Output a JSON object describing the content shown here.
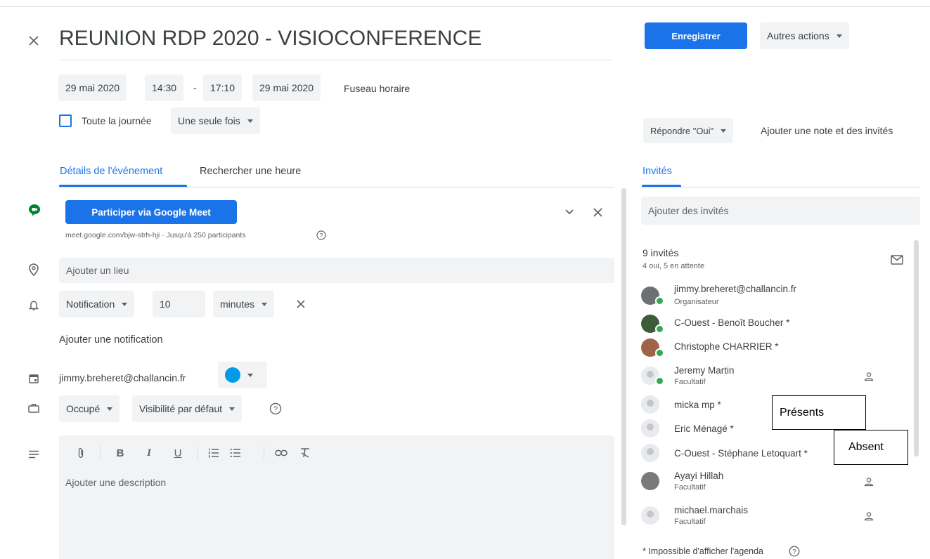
{
  "event": {
    "title": "REUNION RDP 2020 - VISIOCONFERENCE",
    "start_date": "29 mai 2020",
    "start_time": "14:30",
    "separator": "-",
    "end_time": "17:10",
    "end_date": "29 mai 2020",
    "timezone_label": "Fuseau horaire",
    "all_day_label": "Toute la journée",
    "all_day_checked": false,
    "recurrence": "Une seule fois"
  },
  "toolbar": {
    "save_label": "Enregistrer",
    "more_actions_label": "Autres actions"
  },
  "rsvp": {
    "reply_label": "Répondre \"Oui\"",
    "add_note_label": "Ajouter une note et des invités"
  },
  "tabs": {
    "details": "Détails de l'événement",
    "find_time": "Rechercher une heure",
    "guests": "Invités"
  },
  "meet": {
    "join_label": "Participer via Google Meet",
    "link_info": "meet.google.com/bjw-strh-hji · Jusqu'à 250 participants"
  },
  "location": {
    "placeholder": "Ajouter un lieu"
  },
  "notification": {
    "type": "Notification",
    "value": "10",
    "unit": "minutes",
    "add_label": "Ajouter une notification"
  },
  "calendar": {
    "owner": "jimmy.breheret@challancin.fr",
    "color": "#039be5"
  },
  "availability": {
    "status": "Occupé",
    "visibility": "Visibilité par défaut"
  },
  "description": {
    "placeholder": "Ajouter une description"
  },
  "guests": {
    "add_placeholder": "Ajouter des invités",
    "count_label": "9 invités",
    "summary": "4 oui, 5 en attente",
    "list": [
      {
        "name": "jimmy.breheret@challancin.fr",
        "sub": "Organisateur"
      },
      {
        "name": "C-Ouest - Benoît Boucher *",
        "sub": ""
      },
      {
        "name": "Christophe CHARRIER *",
        "sub": ""
      },
      {
        "name": "Jeremy Martin",
        "sub": "Facultatif"
      },
      {
        "name": "micka mp *",
        "sub": ""
      },
      {
        "name": "Eric Ménagé *",
        "sub": ""
      },
      {
        "name": "C-Ouest - Stéphane Letoquart *",
        "sub": ""
      },
      {
        "name": "Ayayi Hillah",
        "sub": "Facultatif"
      },
      {
        "name": "michael.marchais",
        "sub": "Facultatif"
      }
    ],
    "footnote": "* Impossible d'afficher l'agenda"
  },
  "annotations": {
    "present": "Présents",
    "absent": "Absent"
  },
  "colors": {
    "accent": "#1a73e8",
    "accepted": "#34a853",
    "meet_green": "#00832d"
  }
}
